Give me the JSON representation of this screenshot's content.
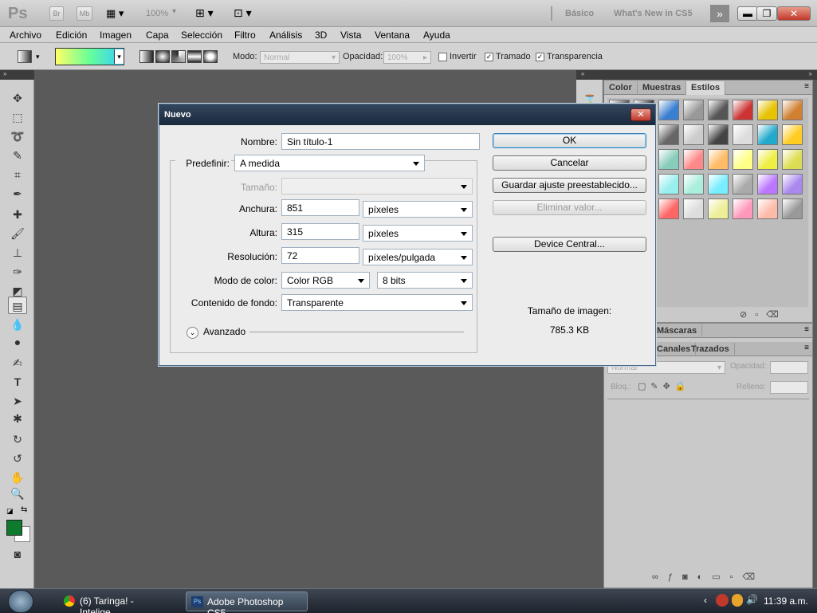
{
  "appbar": {
    "logo": "Ps",
    "br_label": "Br",
    "mb_label": "Mb",
    "zoom": "100%",
    "workspace_basic": "Básico",
    "whats_new": "What's New in CS5"
  },
  "menu": [
    "Archivo",
    "Edición",
    "Imagen",
    "Capa",
    "Selección",
    "Filtro",
    "Análisis",
    "3D",
    "Vista",
    "Ventana",
    "Ayuda"
  ],
  "options": {
    "mode_label": "Modo:",
    "mode_value": "Normal",
    "opacity_label": "Opacidad:",
    "opacity_value": "100%",
    "invert_label": "Invertir",
    "dither_label": "Tramado",
    "transparency_label": "Transparencia",
    "invert_checked": false,
    "dither_checked": true,
    "transparency_checked": true
  },
  "styles_panel": {
    "tabs": [
      "Color",
      "Muestras",
      "Estilos"
    ],
    "active_tab": "Estilos"
  },
  "layers_panel": {
    "tab_masks": "Máscaras",
    "tab_channels": "Canales",
    "tab_paths": "Trazados",
    "mode": "Normal",
    "opacity_label": "Opacidad:",
    "lock_label": "Bloq.:",
    "fill_label": "Relleno:"
  },
  "dialog": {
    "title": "Nuevo",
    "name_label": "Nombre:",
    "name_value": "Sin título-1",
    "preset_label": "Predefinir:",
    "preset_value": "A medida",
    "size_label": "Tamaño:",
    "width_label": "Anchura:",
    "width_value": "851",
    "width_unit": "píxeles",
    "height_label": "Altura:",
    "height_value": "315",
    "height_unit": "píxeles",
    "resolution_label": "Resolución:",
    "resolution_value": "72",
    "resolution_unit": "píxeles/pulgada",
    "color_mode_label": "Modo de color:",
    "color_mode_value": "Color RGB",
    "bit_depth": "8 bits",
    "background_label": "Contenido de fondo:",
    "background_value": "Transparente",
    "advanced_label": "Avanzado",
    "ok_label": "OK",
    "cancel_label": "Cancelar",
    "save_preset_label": "Guardar ajuste preestablecido...",
    "delete_preset_label": "Eliminar valor...",
    "device_central_label": "Device Central...",
    "image_size_label": "Tamaño de imagen:",
    "image_size_value": "785.3 KB"
  },
  "taskbar": {
    "items": [
      "(6) Taringa! - Intelige...",
      "Adobe Photoshop CS5..."
    ],
    "clock": "11:39 a.m."
  },
  "colors": {
    "foreground": "#0d7a2e",
    "background": "#ffffff",
    "gradient_start": "#ffff66",
    "gradient_end": "#33ccff"
  }
}
